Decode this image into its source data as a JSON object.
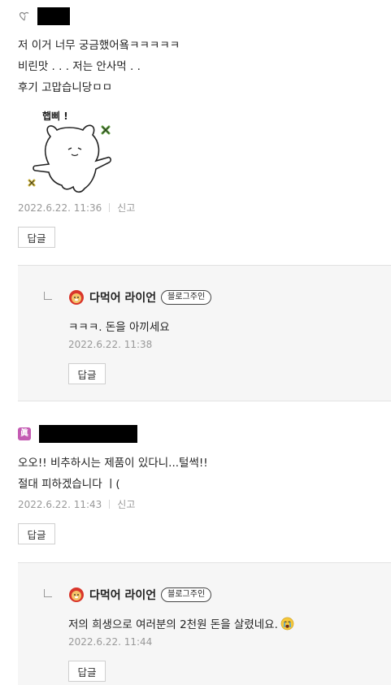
{
  "comments": [
    {
      "lines": [
        "저 이거 너무 궁금했어욬ㅋㅋㅋㅋㅋ",
        "비린맛 . . . 저는 안사먹 . .",
        "후기 고맙습니당ㅁㅁ"
      ],
      "sticker_text": "햅삐 !",
      "time": "2022.6.22. 11:36",
      "report": "신고",
      "reply_label": "답글",
      "reply": {
        "author": "다먹어 라이언",
        "badge": "블로그주인",
        "text": "ㅋㅋㅋ. 돈을 아끼세요",
        "time": "2022.6.22. 11:38",
        "reply_label": "답글"
      }
    },
    {
      "avatar_text": "眞",
      "lines": [
        "오오!! 비추하시는 제품이 있다니...털썩!!",
        "절대 피하겠습니다 ㅣ("
      ],
      "time": "2022.6.22. 11:43",
      "report": "신고",
      "reply_label": "답글",
      "reply": {
        "author": "다먹어 라이언",
        "badge": "블로그주인",
        "text": "저의 희생으로 여러분의 2천원 돈을 살렸네요.",
        "time": "2022.6.22. 11:44",
        "reply_label": "답글"
      }
    }
  ]
}
